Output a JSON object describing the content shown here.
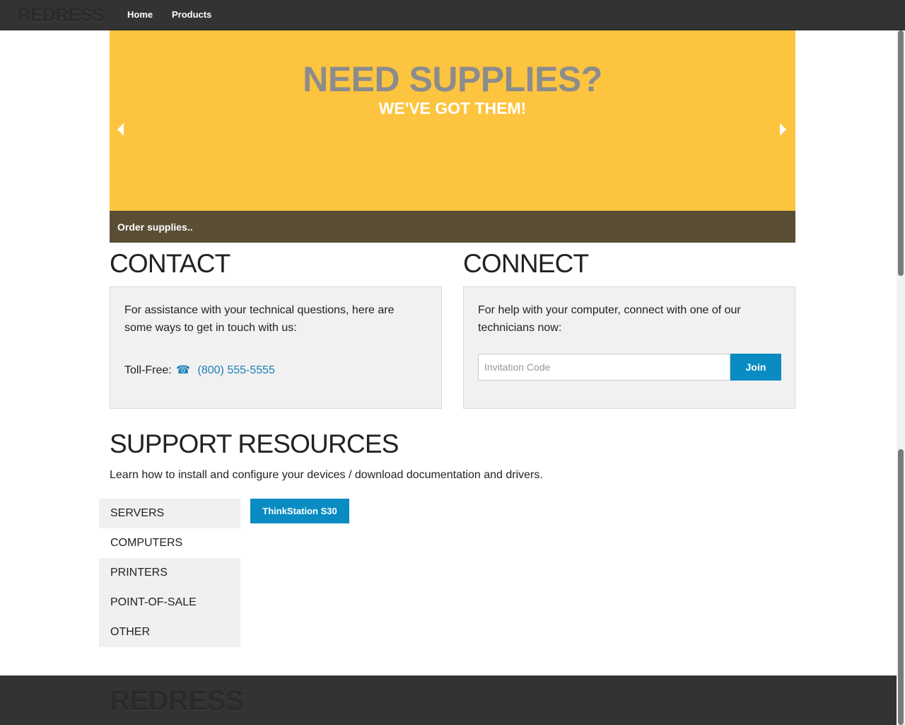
{
  "navbar": {
    "brand": "REDRESS",
    "links": [
      {
        "label": "Home"
      },
      {
        "label": "Products"
      }
    ]
  },
  "carousel": {
    "headline": "NEED SUPPLIES?",
    "subline": "WE'VE GOT THEM!",
    "caption": "Order supplies..",
    "background_color": "#fdc43f",
    "caption_color": "#5a4e34"
  },
  "contact": {
    "title": "CONTACT",
    "text": "For assistance with your technical questions, here are some ways to get in touch with us:",
    "tollfree_label": "Toll-Free:",
    "phone_icon": "☎",
    "phone_number": "(800) 555-5555"
  },
  "connect": {
    "title": "CONNECT",
    "text": "For help with your computer, connect with one of our technicians now:",
    "input_placeholder": "Invitation Code",
    "input_value": "",
    "join_label": "Join"
  },
  "support": {
    "title": "SUPPORT RESOURCES",
    "description": "Learn how to install and configure your devices / download documentation and drivers.",
    "categories": [
      {
        "label": "SERVERS"
      },
      {
        "label": "COMPUTERS"
      },
      {
        "label": "PRINTERS"
      },
      {
        "label": "POINT-OF-SALE"
      },
      {
        "label": "OTHER"
      }
    ],
    "product_button": "ThinkStation S30"
  },
  "footer": {
    "brand": "REDRESS"
  },
  "colors": {
    "accent": "#0a8cc3",
    "navbar": "#333333"
  }
}
